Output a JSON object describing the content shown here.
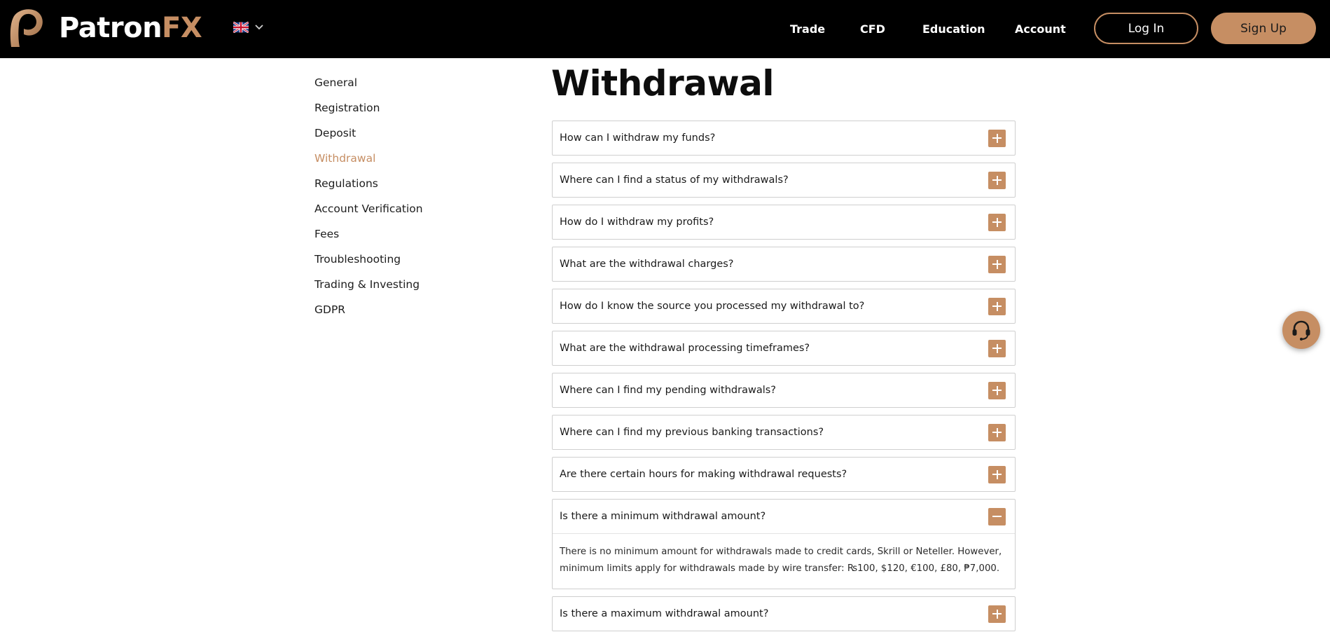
{
  "header": {
    "logo": {
      "word1": "Patron",
      "word2": "FX"
    },
    "language": {
      "flag": "uk-flag",
      "icon": "chevron-down-icon"
    },
    "nav": [
      "Trade",
      "CFD",
      "Education",
      "Account"
    ],
    "login_label": "Log In",
    "signup_label": "Sign Up"
  },
  "sidebar": {
    "items": [
      {
        "label": "General",
        "active": false
      },
      {
        "label": "Registration",
        "active": false
      },
      {
        "label": "Deposit",
        "active": false
      },
      {
        "label": "Withdrawal",
        "active": true
      },
      {
        "label": "Regulations",
        "active": false
      },
      {
        "label": "Account Verification",
        "active": false
      },
      {
        "label": "Fees",
        "active": false
      },
      {
        "label": "Troubleshooting",
        "active": false
      },
      {
        "label": "Trading & Investing",
        "active": false
      },
      {
        "label": "GDPR",
        "active": false
      }
    ]
  },
  "main": {
    "title": "Withdrawal",
    "faq": [
      {
        "question": "How can I withdraw my funds?",
        "expanded": false
      },
      {
        "question": "Where can I find a status of my withdrawals?",
        "expanded": false
      },
      {
        "question": "How do I withdraw my profits?",
        "expanded": false
      },
      {
        "question": "What are the withdrawal charges?",
        "expanded": false
      },
      {
        "question": "How do I know the source you processed my withdrawal to?",
        "expanded": false
      },
      {
        "question": "What are the withdrawal processing timeframes?",
        "expanded": false
      },
      {
        "question": "Where can I find my pending withdrawals?",
        "expanded": false
      },
      {
        "question": "Where can I find my previous banking transactions?",
        "expanded": false
      },
      {
        "question": "Are there certain hours for making withdrawal requests?",
        "expanded": false
      },
      {
        "question": "Is there a minimum withdrawal amount?",
        "expanded": true,
        "answer": [
          "There is no minimum amount for withdrawals made to credit cards, Skrill or Neteller. However,",
          "minimum limits apply for withdrawals made by wire transfer: ₨100, $120, €100, £80, ₱7,000."
        ]
      },
      {
        "question": "Is there a maximum withdrawal amount?",
        "expanded": false
      }
    ]
  },
  "support_widget": {
    "icon": "headset-icon"
  },
  "colors": {
    "accent": "#c68e63",
    "header_bg": "#000000",
    "text": "#1a1a1a",
    "border": "#cfcfcf"
  }
}
